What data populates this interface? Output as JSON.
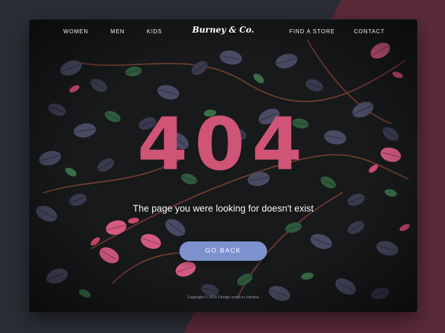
{
  "nav": {
    "left_items": [
      "WOMEN",
      "MEN",
      "KIDS"
    ],
    "right_items": [
      "FIND A STORE",
      "CONTACT"
    ],
    "brand": "Burney & Co."
  },
  "error": {
    "code": "404",
    "message": "The page you were looking for doesn't exist",
    "button_label": "GO BACK"
  },
  "footer": {
    "copyright": "Copyright © 2016 Design made in Ukraine"
  },
  "colors": {
    "page_background": "#2b2d36",
    "accent_diagonal": "#5a2a3a",
    "code": "#d9587a",
    "button": "#7c92cf",
    "leaf_dark": "#4a4a63",
    "leaf_green": "#2f5a3c",
    "leaf_pink": "#d35a80"
  }
}
